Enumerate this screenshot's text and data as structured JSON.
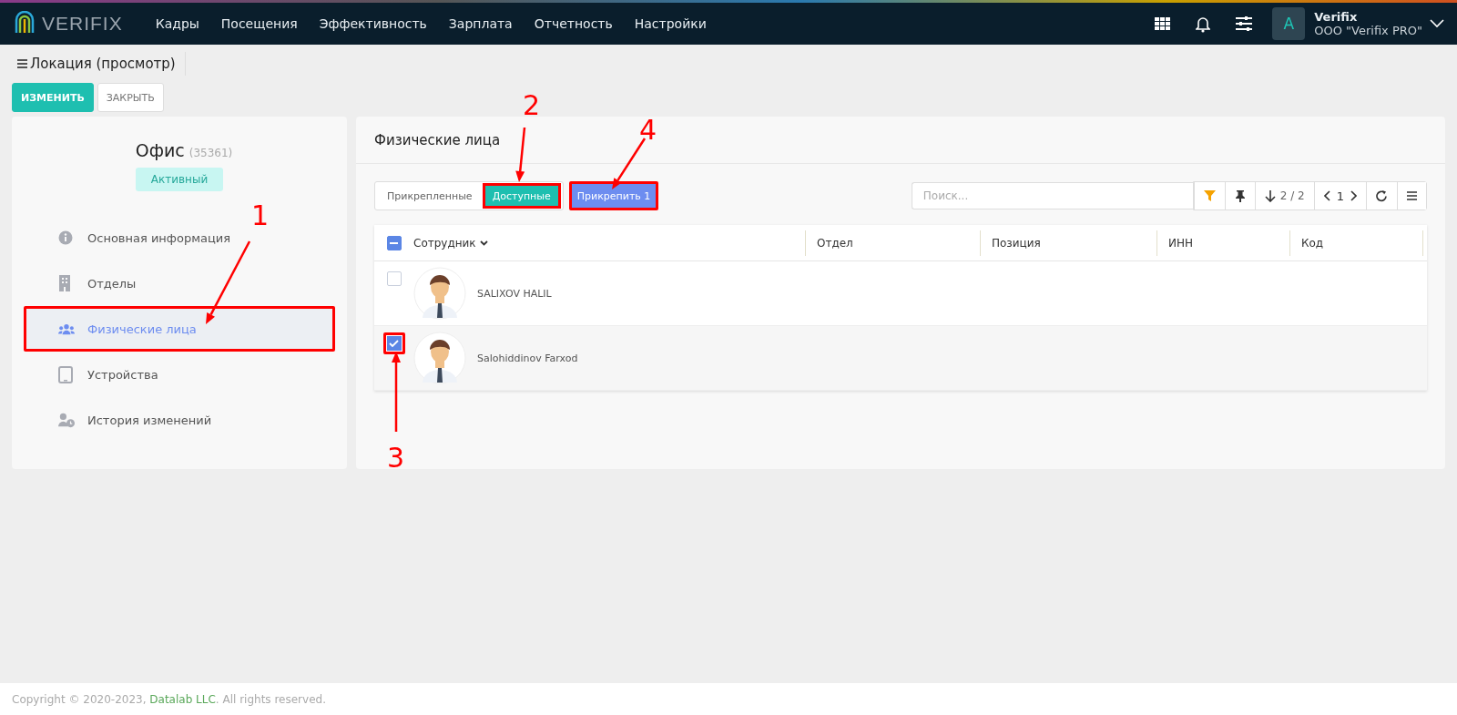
{
  "topbar": {
    "logo": "VERIFIX",
    "menu": [
      "Кадры",
      "Посещения",
      "Эффективность",
      "Зарплата",
      "Отчетность",
      "Настройки"
    ],
    "user": {
      "avatar": "A",
      "name": "Verifix",
      "company": "OOO \"Verifix PRO\""
    }
  },
  "page": {
    "title": "Локация (просмотр)",
    "buttons": [
      {
        "label": "ИЗМЕНИТЬ",
        "kind": "primary"
      },
      {
        "label": "ЗАКРЫТЬ",
        "kind": "default"
      }
    ]
  },
  "location": {
    "name": "Офис",
    "code": "(35361)",
    "status": "Активный"
  },
  "nav": [
    {
      "label": "Основная информация",
      "selected": false,
      "highlighted": false
    },
    {
      "label": "Отделы",
      "selected": false,
      "highlighted": false
    },
    {
      "label": "Физические лица",
      "selected": true,
      "highlighted": true
    },
    {
      "label": "Устройства",
      "selected": false,
      "highlighted": false
    },
    {
      "label": "История изменений",
      "selected": false,
      "highlighted": false
    }
  ],
  "panel": {
    "title": "Физические лица",
    "tabs": [
      {
        "label": "Прикрепленные",
        "selected": false,
        "highlighted": false
      },
      {
        "label": "Доступные",
        "selected": true,
        "highlighted": true
      }
    ],
    "attach_button": {
      "label": "Прикрепить 1",
      "highlighted": true
    },
    "search": {
      "placeholder": "Поиск..."
    },
    "count": "2 / 2",
    "page": "1"
  },
  "table": {
    "select_all": {
      "indeterminate": true
    },
    "columns": [
      {
        "label": "Сотрудник",
        "sorted": true
      },
      {
        "label": "Отдел",
        "sorted": false
      },
      {
        "label": "Позиция",
        "sorted": false
      },
      {
        "label": "ИНН",
        "sorted": false
      },
      {
        "label": "Код",
        "sorted": false
      }
    ],
    "rows": [
      {
        "name": "SALIXOV HALIL",
        "checked": false,
        "highlighted": false
      },
      {
        "name": "Salohiddinov Farxod",
        "checked": true,
        "highlighted": true
      }
    ]
  },
  "annotations": [
    {
      "label": "1"
    },
    {
      "label": "2"
    },
    {
      "label": "3"
    },
    {
      "label": "4"
    }
  ],
  "footer": {
    "before": "Copyright © 2020-2023, ",
    "link": "Datalab LLC",
    "after": ". All rights reserved."
  }
}
